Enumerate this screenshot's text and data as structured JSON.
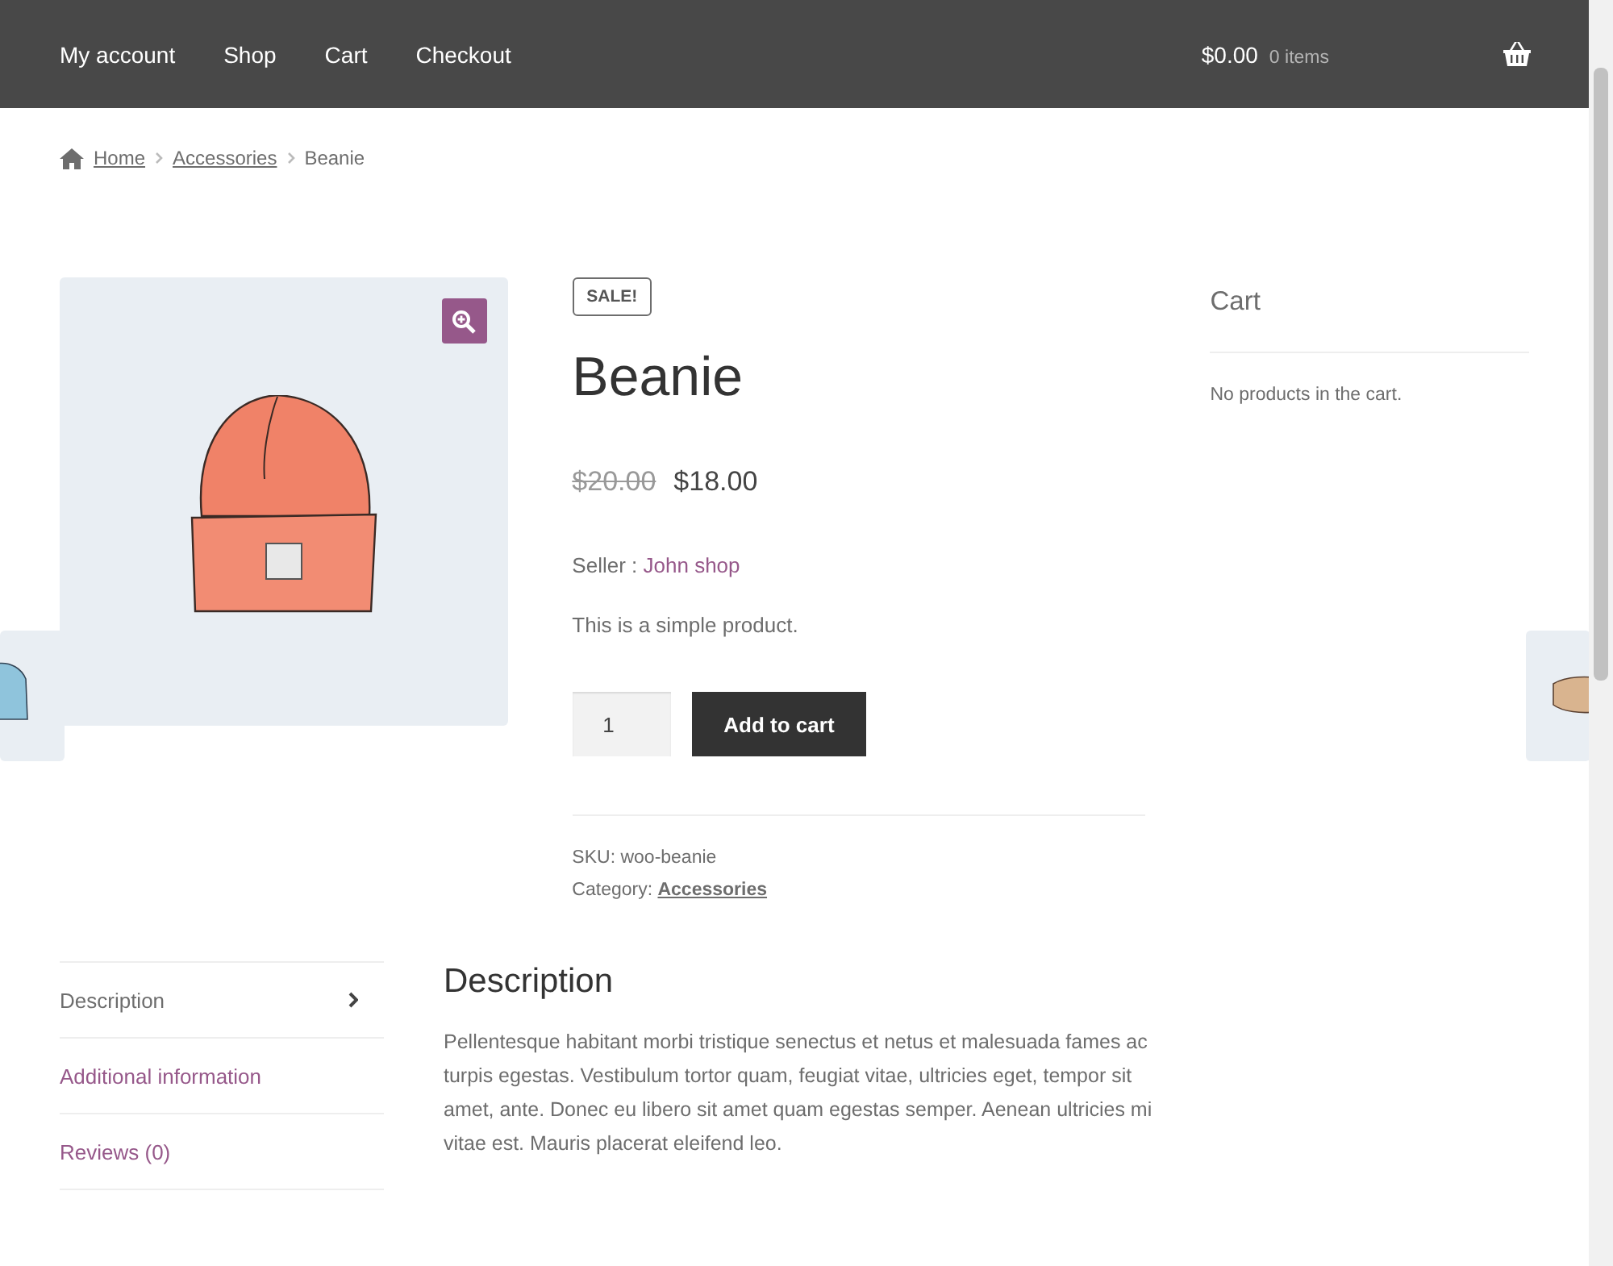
{
  "nav": {
    "links": [
      {
        "label": "My account"
      },
      {
        "label": "Shop"
      },
      {
        "label": "Cart"
      },
      {
        "label": "Checkout"
      }
    ],
    "cart_total": "$0.00",
    "cart_count": "0 items"
  },
  "breadcrumb": [
    {
      "label": "Home",
      "kind": "link"
    },
    {
      "label": "Accessories",
      "kind": "link"
    },
    {
      "label": "Beanie",
      "kind": "current"
    }
  ],
  "product": {
    "badge": "SALE!",
    "title": "Beanie",
    "old_price": "$20.00",
    "price": "$18.00",
    "seller_label": "Seller :",
    "seller": "John shop",
    "short_description": "This is a simple product.",
    "quantity": "1",
    "add_button": "Add to cart",
    "sku_label": "SKU:",
    "sku": "woo-beanie",
    "category_label": "Category:",
    "category": "Accessories"
  },
  "sidebar": {
    "title": "Cart",
    "empty_text": "No products in the cart."
  },
  "tabs": [
    {
      "label": "Description",
      "selected": true
    },
    {
      "label": "Additional information",
      "selected": false
    },
    {
      "label": "Reviews (0)",
      "selected": false
    }
  ],
  "panel": {
    "title": "Description",
    "text": "Pellentesque habitant morbi tristique senectus et netus et malesuada fames ac turpis egestas. Vestibulum tortor quam, feugiat vitae, ultricies eget, tempor sit amet, ante. Donec eu libero sit amet quam egestas semper. Aenean ultricies mi vitae est. Mauris placerat eleifend leo."
  }
}
